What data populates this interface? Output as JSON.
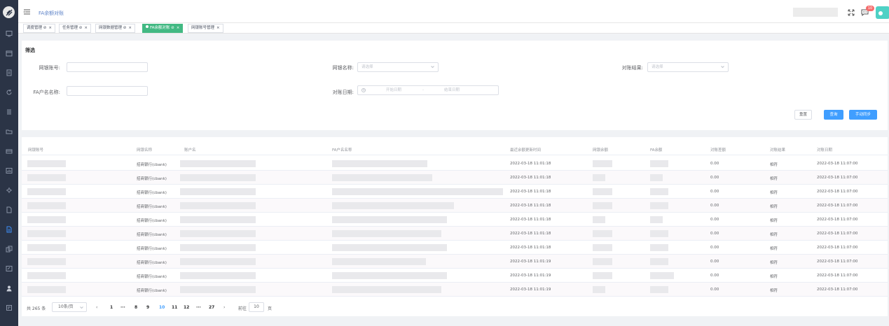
{
  "header": {
    "title": "FA余额对账",
    "badge_count": "10"
  },
  "tabs": [
    {
      "label": "调度管理 ⊘"
    },
    {
      "label": "任务管理 ⊘"
    },
    {
      "label": "网银数据管理 ⊘"
    },
    {
      "label": "FA余额对账 ⊘"
    },
    {
      "label": "网银账号管理"
    }
  ],
  "filter": {
    "title": "筛选",
    "account_no_label": "网银账号:",
    "bank_name_label": "网银名称:",
    "bank_name_placeholder": "请选择",
    "result_label": "对账结果:",
    "result_placeholder": "请选择",
    "fa_name_label": "FA户名名称:",
    "date_label": "对账日期:",
    "date_start_placeholder": "开始日期",
    "date_sep": "-",
    "date_end_placeholder": "结束日期",
    "reset_label": "重置",
    "query_label": "查询",
    "sync_label": "手动同步"
  },
  "table": {
    "columns": [
      "网银账号",
      "网银名称",
      "账户名",
      "FA户名名称",
      "最近余额更新时间",
      "网银余额",
      "FA余额",
      "对账差额",
      "对账结果",
      "对账日期"
    ],
    "rows": [
      {
        "bank": "招商银行(cbank)",
        "update": "2022-03-18 11:01:18",
        "diff": "0.00",
        "result": "相符",
        "date": "2022-03-18 11:07:00"
      },
      {
        "bank": "招商银行(cbank)",
        "update": "2022-03-18 11:01:18",
        "diff": "0.00",
        "result": "相符",
        "date": "2022-03-18 11:07:00"
      },
      {
        "bank": "招商银行(cbank)",
        "update": "2022-03-18 11:01:18",
        "diff": "0.00",
        "result": "相符",
        "date": "2022-03-18 11:07:00"
      },
      {
        "bank": "招商银行(cbank)",
        "update": "2022-03-18 11:01:18",
        "diff": "0.00",
        "result": "相符",
        "date": "2022-03-18 11:07:00"
      },
      {
        "bank": "招商银行(cbank)",
        "update": "2022-03-18 11:01:18",
        "diff": "0.00",
        "result": "相符",
        "date": "2022-03-18 11:07:00"
      },
      {
        "bank": "招商银行(cbank)",
        "update": "2022-03-18 11:01:18",
        "diff": "0.00",
        "result": "相符",
        "date": "2022-03-18 11:07:00"
      },
      {
        "bank": "招商银行(cbank)",
        "update": "2022-03-18 11:01:18",
        "diff": "0.00",
        "result": "相符",
        "date": "2022-03-18 11:07:00"
      },
      {
        "bank": "招商银行(cbank)",
        "update": "2022-03-18 11:01:19",
        "diff": "0.00",
        "result": "相符",
        "date": "2022-03-18 11:07:00"
      },
      {
        "bank": "招商银行(cbank)",
        "update": "2022-03-18 11:01:19",
        "diff": "0.00",
        "result": "相符",
        "date": "2022-03-18 11:07:00"
      },
      {
        "bank": "招商银行(cbank)",
        "update": "2022-03-18 11:01:19",
        "diff": "0.00",
        "result": "相符",
        "date": "2022-03-18 11:07:00"
      }
    ]
  },
  "pagination": {
    "total": "共 265 条",
    "page_size": "10条/页",
    "prev": "‹",
    "next": "›",
    "pages": [
      "1",
      "···",
      "8",
      "9",
      "10",
      "11",
      "12",
      "···",
      "27"
    ],
    "current": "10",
    "goto_label": "前往",
    "goto_value": "10",
    "goto_suffix": "页"
  },
  "colors": {
    "sidebar": "#2b3446",
    "primary": "#409eff",
    "active_tab": "#42b983",
    "badge": "#f56c6c"
  },
  "icons": {
    "sidebar": [
      "dashboard-icon",
      "calendar-icon",
      "document-icon",
      "refresh-icon",
      "list-icon",
      "folder-icon",
      "card-icon",
      "chart-icon",
      "settings-icon",
      "file-icon",
      "reconcile-icon",
      "copy-icon",
      "edit-icon",
      "user-icon",
      "report-icon"
    ]
  }
}
